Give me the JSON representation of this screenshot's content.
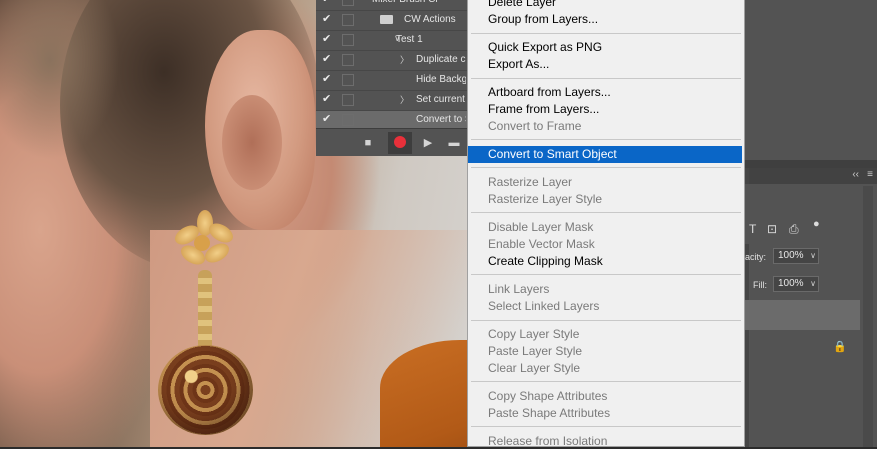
{
  "actions_panel": {
    "rows": [
      {
        "text": "Mixer Brush Cl",
        "checked": true,
        "indent": 0,
        "has_twisty": false,
        "folder": false
      },
      {
        "text": "CW Actions",
        "checked": true,
        "indent": 1,
        "has_twisty": true,
        "twisty": "∨",
        "folder": true
      },
      {
        "text": "Test 1",
        "checked": true,
        "indent": 2,
        "has_twisty": true,
        "twisty": "∨",
        "folder": false
      },
      {
        "text": "Duplicate c",
        "checked": true,
        "indent": 3,
        "has_twisty": true,
        "twisty": "〉",
        "folder": false
      },
      {
        "text": "Hide Backg",
        "checked": true,
        "indent": 3,
        "has_twisty": false,
        "folder": false
      },
      {
        "text": "Set current",
        "checked": true,
        "indent": 3,
        "has_twisty": true,
        "twisty": "〉",
        "folder": false
      },
      {
        "text": "Convert to S",
        "checked": true,
        "indent": 3,
        "has_twisty": false,
        "folder": false,
        "selected": true
      }
    ],
    "checkmark": "✔",
    "toolbar": {
      "stop": "■",
      "play": "▶",
      "folder": "▬"
    },
    "record_color": "#e8303a"
  },
  "context_menu": {
    "items": [
      {
        "label": "Delete Layer",
        "enabled": true
      },
      {
        "label": "Group from Layers...",
        "enabled": true
      },
      {
        "label": "Quick Export as PNG",
        "enabled": true
      },
      {
        "label": "Export As...",
        "enabled": true
      },
      {
        "label": "Artboard from Layers...",
        "enabled": true
      },
      {
        "label": "Frame from Layers...",
        "enabled": true
      },
      {
        "label": "Convert to Frame",
        "enabled": false
      },
      {
        "label": "Convert to Smart Object",
        "enabled": true,
        "highlighted": true
      },
      {
        "label": "Rasterize Layer",
        "enabled": false
      },
      {
        "label": "Rasterize Layer Style",
        "enabled": false
      },
      {
        "label": "Disable Layer Mask",
        "enabled": false
      },
      {
        "label": "Enable Vector Mask",
        "enabled": false
      },
      {
        "label": "Create Clipping Mask",
        "enabled": true
      },
      {
        "label": "Link Layers",
        "enabled": false
      },
      {
        "label": "Select Linked Layers",
        "enabled": false
      },
      {
        "label": "Copy Layer Style",
        "enabled": false
      },
      {
        "label": "Paste Layer Style",
        "enabled": false
      },
      {
        "label": "Clear Layer Style",
        "enabled": false
      },
      {
        "label": "Copy Shape Attributes",
        "enabled": false
      },
      {
        "label": "Paste Shape Attributes",
        "enabled": false
      },
      {
        "label": "Release from Isolation",
        "enabled": false
      }
    ],
    "highlight_color": "#0a66c7"
  },
  "layers_panel": {
    "collapse_glyph": "‹‹",
    "menu_glyph": "≡",
    "filter_icons": [
      "T",
      "⊡",
      "⎙",
      "●"
    ],
    "opacity_label": "acity:",
    "opacity_value": "100%",
    "fill_label": "Fill:",
    "fill_value": "100%",
    "dropdown_glyph": "∨",
    "lock_glyph": "🔒"
  }
}
